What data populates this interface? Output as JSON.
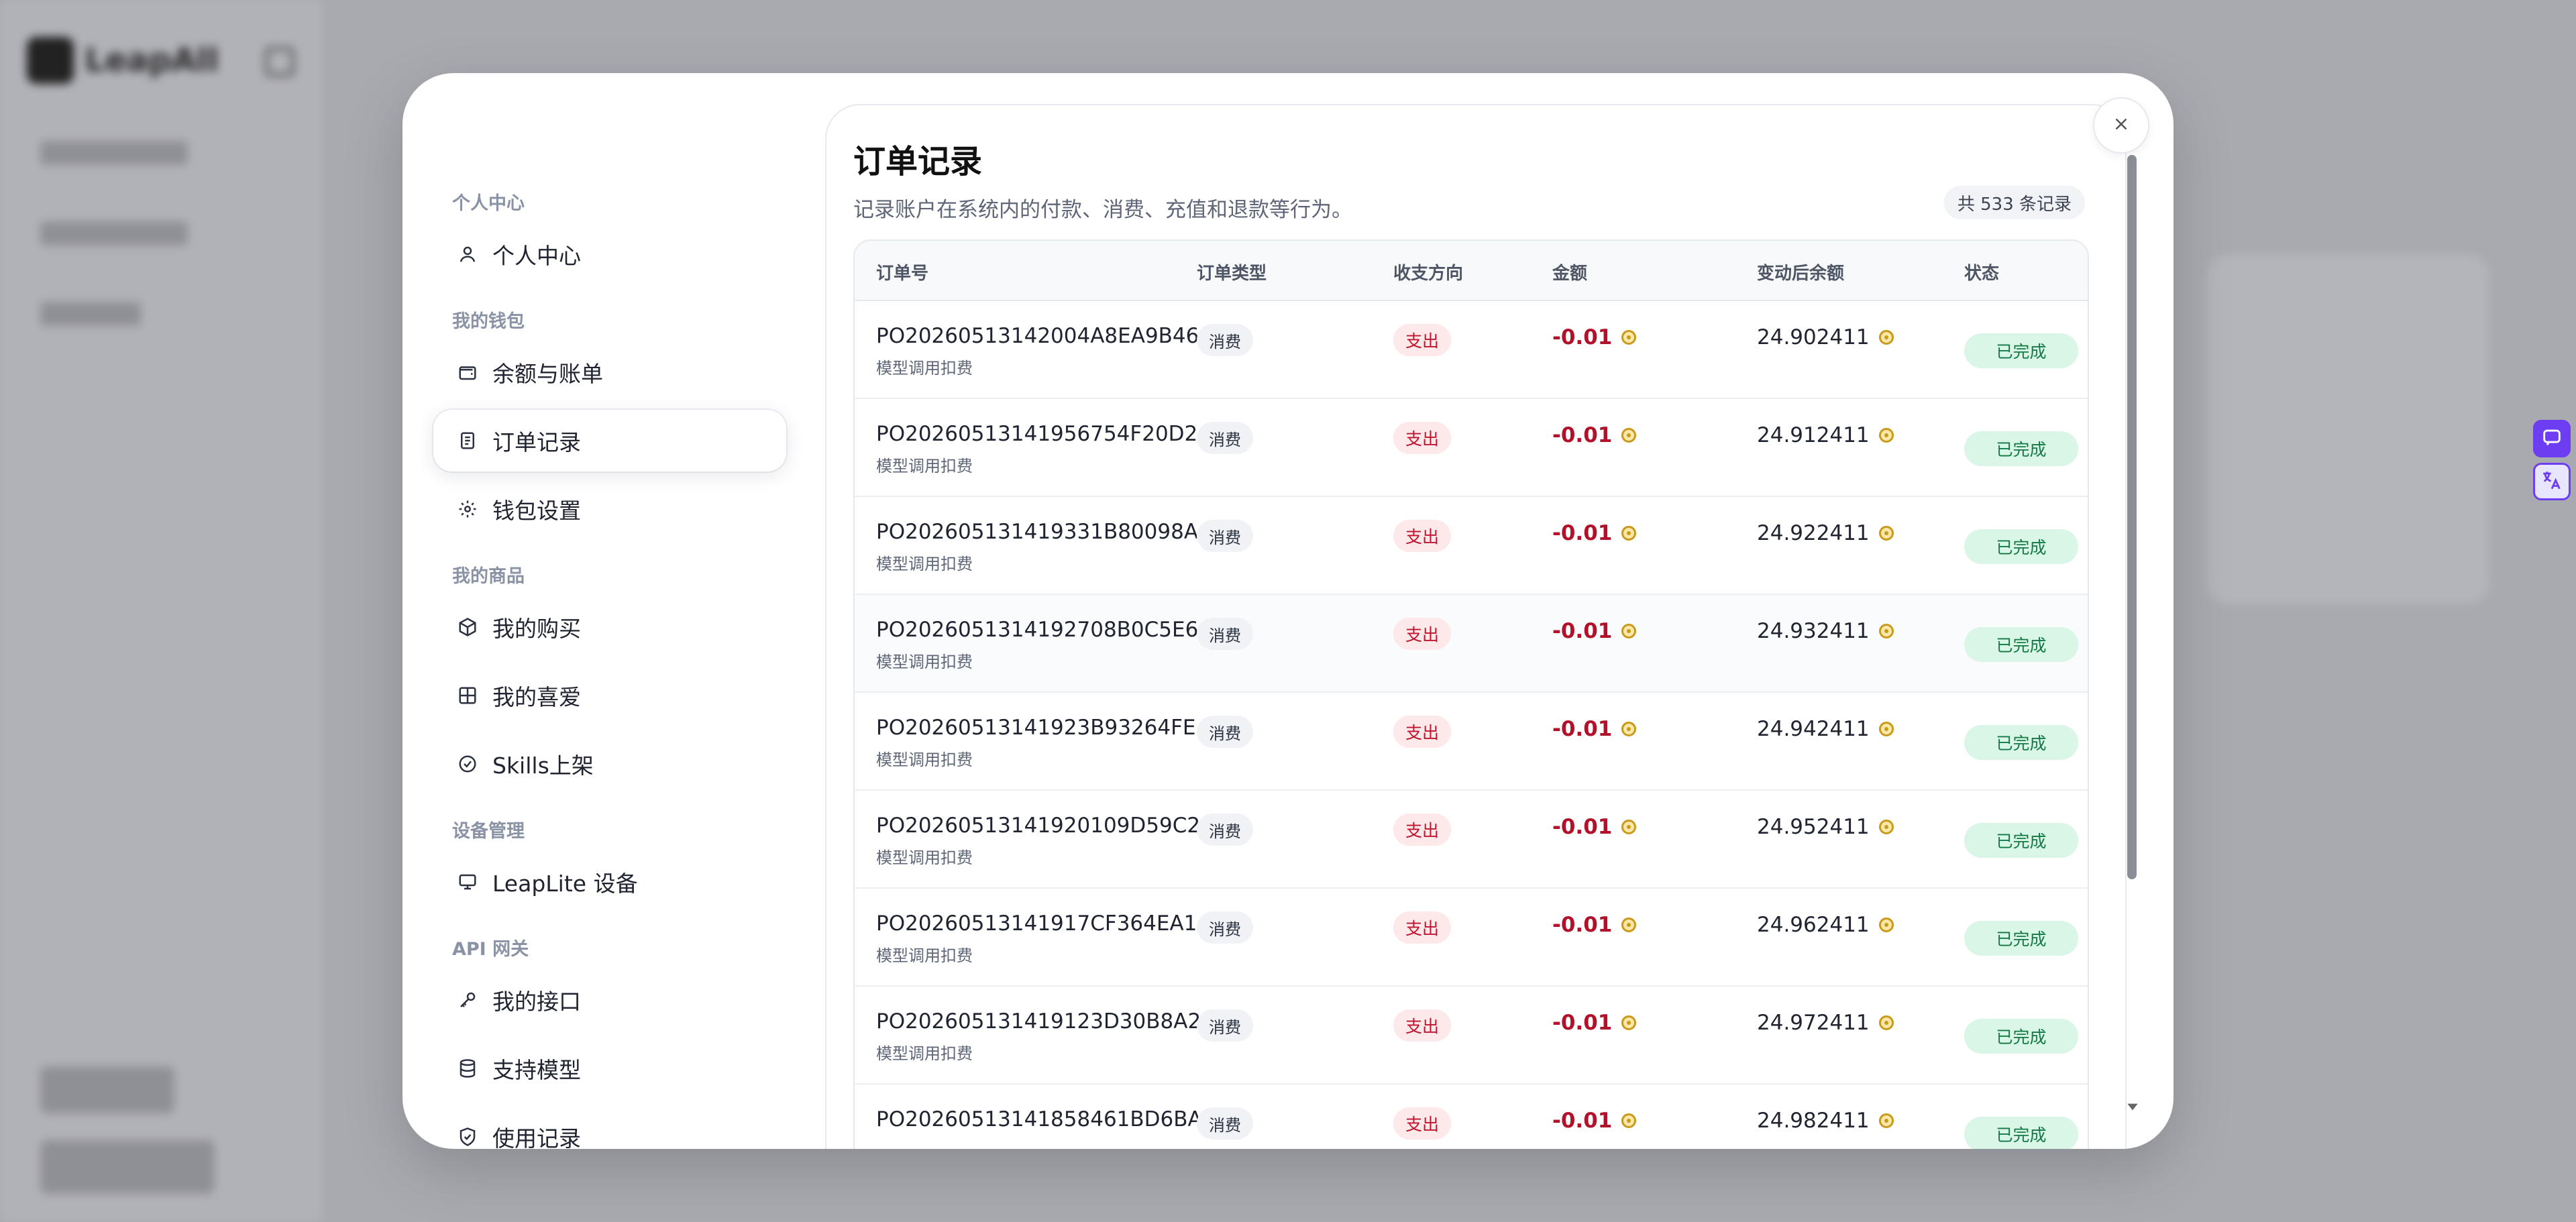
{
  "background": {
    "logo_text": "LeapAll"
  },
  "sidebar": {
    "sections": [
      {
        "title": "个人中心",
        "items": [
          {
            "label": "个人中心",
            "icon": "user-icon"
          }
        ]
      },
      {
        "title": "我的钱包",
        "items": [
          {
            "label": "余额与账单",
            "icon": "wallet-icon"
          },
          {
            "label": "订单记录",
            "icon": "receipt-icon",
            "active": true
          },
          {
            "label": "钱包设置",
            "icon": "gear-icon"
          }
        ]
      },
      {
        "title": "我的商品",
        "items": [
          {
            "label": "我的购买",
            "icon": "package-icon"
          },
          {
            "label": "我的喜爱",
            "icon": "grid-icon"
          },
          {
            "label": "Skills上架",
            "icon": "check-circle-icon"
          }
        ]
      },
      {
        "title": "设备管理",
        "items": [
          {
            "label": "LeapLite 设备",
            "icon": "monitor-icon"
          }
        ]
      },
      {
        "title": "API 网关",
        "items": [
          {
            "label": "我的接口",
            "icon": "key-icon"
          },
          {
            "label": "支持模型",
            "icon": "database-icon"
          },
          {
            "label": "使用记录",
            "icon": "shield-icon"
          }
        ]
      }
    ]
  },
  "main": {
    "title": "订单记录",
    "subtitle": "记录账户在系统内的付款、消费、充值和退款等行为。",
    "count_badge": "共 533 条记录",
    "columns": [
      "订单号",
      "订单类型",
      "收支方向",
      "金额",
      "变动后余额",
      "状态"
    ],
    "rows": [
      {
        "order_no": "PO20260513142004A8EA9B46",
        "desc": "模型调用扣费",
        "type": "消费",
        "direction": "支出",
        "amount": "-0.01",
        "balance": "24.902411",
        "status": "已完成"
      },
      {
        "order_no": "PO20260513141956754F20D2",
        "desc": "模型调用扣费",
        "type": "消费",
        "direction": "支出",
        "amount": "-0.01",
        "balance": "24.912411",
        "status": "已完成"
      },
      {
        "order_no": "PO202605131419331B80098A",
        "desc": "模型调用扣费",
        "type": "消费",
        "direction": "支出",
        "amount": "-0.01",
        "balance": "24.922411",
        "status": "已完成"
      },
      {
        "order_no": "PO2026051314192708B0C5E6",
        "desc": "模型调用扣费",
        "type": "消费",
        "direction": "支出",
        "amount": "-0.01",
        "balance": "24.932411",
        "status": "已完成"
      },
      {
        "order_no": "PO20260513141923B93264FE",
        "desc": "模型调用扣费",
        "type": "消费",
        "direction": "支出",
        "amount": "-0.01",
        "balance": "24.942411",
        "status": "已完成"
      },
      {
        "order_no": "PO20260513141920109D59C2",
        "desc": "模型调用扣费",
        "type": "消费",
        "direction": "支出",
        "amount": "-0.01",
        "balance": "24.952411",
        "status": "已完成"
      },
      {
        "order_no": "PO20260513141917CF364EA1",
        "desc": "模型调用扣费",
        "type": "消费",
        "direction": "支出",
        "amount": "-0.01",
        "balance": "24.962411",
        "status": "已完成"
      },
      {
        "order_no": "PO202605131419123D30B8A2",
        "desc": "模型调用扣费",
        "type": "消费",
        "direction": "支出",
        "amount": "-0.01",
        "balance": "24.972411",
        "status": "已完成"
      },
      {
        "order_no": "PO20260513141858461BD6BA",
        "desc": "",
        "type": "消费",
        "direction": "支出",
        "amount": "-0.01",
        "balance": "24.982411",
        "status": "已完成"
      }
    ]
  },
  "colors": {
    "accent_purple": "#6d3df2",
    "negative_red": "#b3102a",
    "status_green": "#147a45"
  }
}
